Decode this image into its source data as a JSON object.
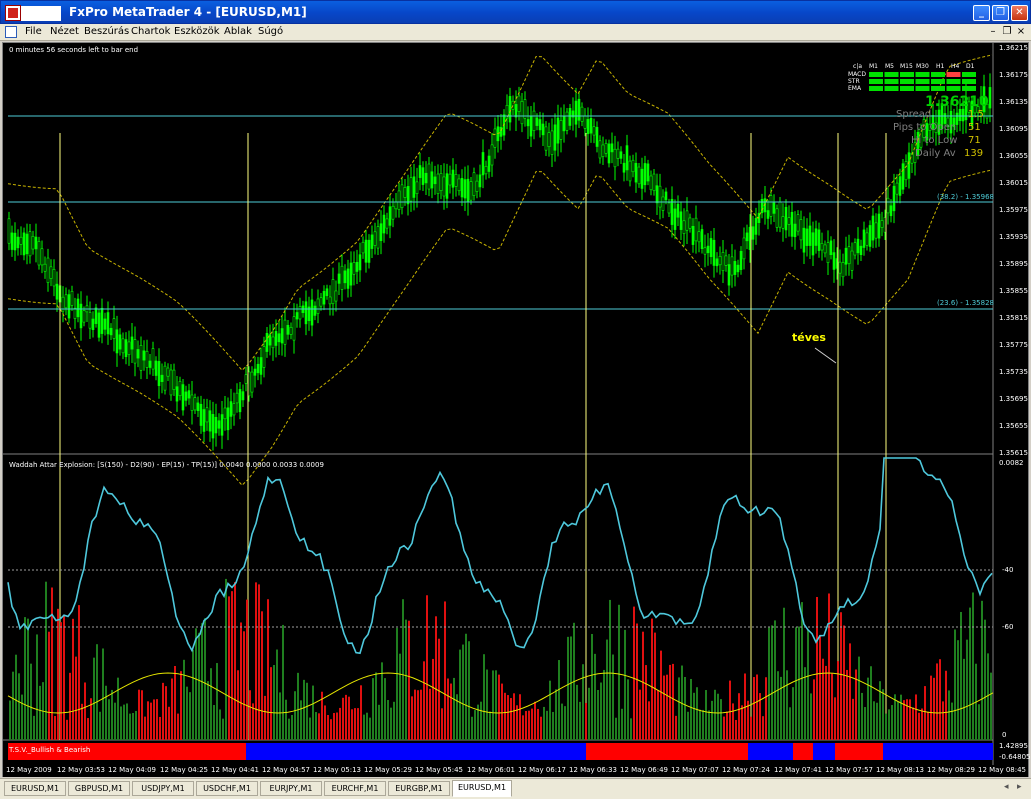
{
  "window": {
    "title": "FxPro MetaTrader 4 - [EURUSD,M1]",
    "min": "_",
    "restore": "❐",
    "close": "✕"
  },
  "menu": {
    "items": [
      "File",
      "Nézet",
      "Beszúrás",
      "Chartok",
      "Eszközök",
      "Ablak",
      "Súgó"
    ],
    "mdi": [
      "–",
      "❐",
      "×"
    ]
  },
  "chart": {
    "countdown": "0 minutes 56 seconds left to bar end",
    "annotation": "téves",
    "price_labels": [
      "1.36215",
      "1.36175",
      "1.36135",
      "1.36095",
      "1.36055",
      "1.36015",
      "1.35975",
      "1.35935",
      "1.35895",
      "1.35855",
      "1.35815",
      "1.35775",
      "1.35735",
      "1.35695",
      "1.35655",
      "1.35615"
    ],
    "fib_labels": [
      "(38.2) - 1.35968",
      "(23.6) - 1.35828"
    ],
    "info_panel": {
      "tf_headers": [
        "c|a",
        "M1",
        "M5",
        "M15",
        "M30",
        "H1",
        "H4",
        "D1"
      ],
      "indicators": [
        "MACD",
        "STR",
        "EMA"
      ],
      "bid": "1.36210",
      "rows": [
        {
          "label": "Spread",
          "value": "1.5"
        },
        {
          "label": "Pips to Open",
          "value": "51"
        },
        {
          "label": "Hi to Low",
          "value": "71"
        },
        {
          "label": "Daily Av",
          "value": "139"
        }
      ]
    },
    "oscillator": {
      "header": "Waddah Attar Explosion: [S(150) - D2(90) - EP(15) - TP(15)] 0.0040 0.0000 0.0033 0.0009",
      "scale_labels": [
        "0.0082",
        "-40",
        "-60",
        "0"
      ]
    },
    "tsv": {
      "label": "T.S.V._Bullish & Bearish",
      "scale_labels": [
        "1.42895",
        "-0.64805"
      ],
      "colors": {
        "bullish": "#0000ff",
        "bearish": "#ff0000"
      }
    },
    "time_labels": [
      "12 May 2009",
      "12 May 03:53",
      "12 May 04:09",
      "12 May 04:25",
      "12 May 04:41",
      "12 May 04:57",
      "12 May 05:13",
      "12 May 05:29",
      "12 May 05:45",
      "12 May 06:01",
      "12 May 06:17",
      "12 May 06:33",
      "12 May 06:49",
      "12 May 07:07",
      "12 May 07:24",
      "12 May 07:41",
      "12 May 07:57",
      "12 May 08:13",
      "12 May 08:29",
      "12 May 08:45"
    ],
    "colors": {
      "background": "#000000",
      "candles": "#00ff00",
      "fib_lines": "#4ecbd6",
      "vlines": "#ffff80",
      "osc_green": "#1f7f1f",
      "osc_red": "#e01010",
      "osc_line": "#4ec8dc"
    }
  },
  "tabs": {
    "items": [
      "EURUSD,M1",
      "GBPUSD,M1",
      "USDJPY,M1",
      "USDCHF,M1",
      "EURJPY,M1",
      "EURCHF,M1",
      "EURGBP,M1",
      "EURUSD,M1"
    ],
    "active_index": 7,
    "arrows": [
      "◂",
      "▸"
    ]
  }
}
